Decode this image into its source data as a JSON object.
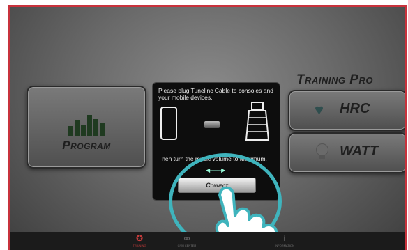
{
  "program": {
    "label": "Program"
  },
  "training_pro": {
    "title": "Training Pro",
    "hrc_label": "HRC",
    "watt_label": "WATT"
  },
  "dialog": {
    "message_line1": "Please plug Tunelinc Cable to consoles and your mobile devices.",
    "message_line2": "Then turn the music volume to Maximum.",
    "connect_label": "Connect"
  },
  "bottom_nav": [
    {
      "label": "TRAINING",
      "icon": "runner-icon",
      "active": true
    },
    {
      "label": "GYM CENTER",
      "icon": "rings-icon",
      "active": false
    },
    {
      "label": "INFORMATION",
      "icon": "info-icon",
      "active": false
    }
  ],
  "colors": {
    "accent_teal": "#3fb4bd",
    "frame_red": "#c8323c",
    "active_red": "#c43b3b"
  }
}
